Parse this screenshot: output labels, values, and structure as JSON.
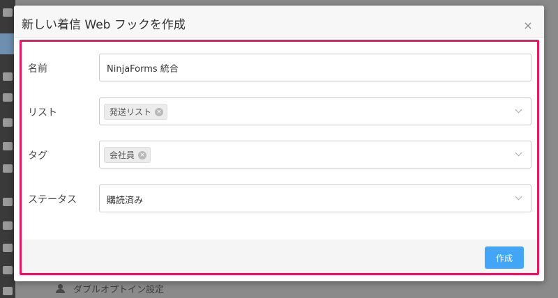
{
  "modal": {
    "title": "新しい着信 Web フックを作成",
    "close_icon": "×"
  },
  "form": {
    "name": {
      "label": "名前",
      "value": "NinjaForms 統合"
    },
    "list": {
      "label": "リスト",
      "chips": [
        "発送リスト"
      ]
    },
    "tag": {
      "label": "タグ",
      "chips": [
        "会社員"
      ]
    },
    "status": {
      "label": "ステータス",
      "value": "購読済み"
    }
  },
  "footer": {
    "create_label": "作成"
  },
  "background": {
    "footer_item": "ダブルオプトイン設定"
  },
  "colors": {
    "highlight": "#e8175d",
    "primary_button": "#42a5f5"
  }
}
